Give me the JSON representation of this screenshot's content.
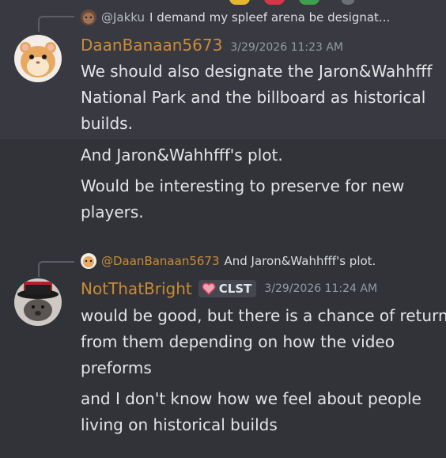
{
  "colors": {
    "username_gold": "#c98c36",
    "background": "#323339",
    "hover": "#393a41"
  },
  "top_reply": {
    "avatar_icon": "hamster-avatar-icon",
    "name": "@Jakku",
    "text": "I demand my spleef arena be designat..."
  },
  "message1": {
    "username": "DaanBanaan5673",
    "timestamp": "3/29/2026 11:23 AM",
    "avatar_icon": "hamster-avatar-icon",
    "lines": [
      "We should also designate the Jaron&Wahhfff",
      "National Park and the billboard as historical",
      "builds.",
      "And Jaron&Wahhfff's plot.",
      "Would be interesting to preserve for new",
      "players."
    ]
  },
  "reply2": {
    "name": "@DaanBanaan5673",
    "text": "And Jaron&Wahhfff's plot."
  },
  "message2": {
    "username": "NotThatBright",
    "tag": "CLST",
    "timestamp": "3/29/2026 11:24 AM",
    "avatar_icon": "hat-avatar-icon",
    "lines": [
      "would be good, but there is a chance of return",
      "from them depending on how the video",
      "preforms",
      "and I don't know how we feel about people",
      "living on historical builds"
    ]
  }
}
